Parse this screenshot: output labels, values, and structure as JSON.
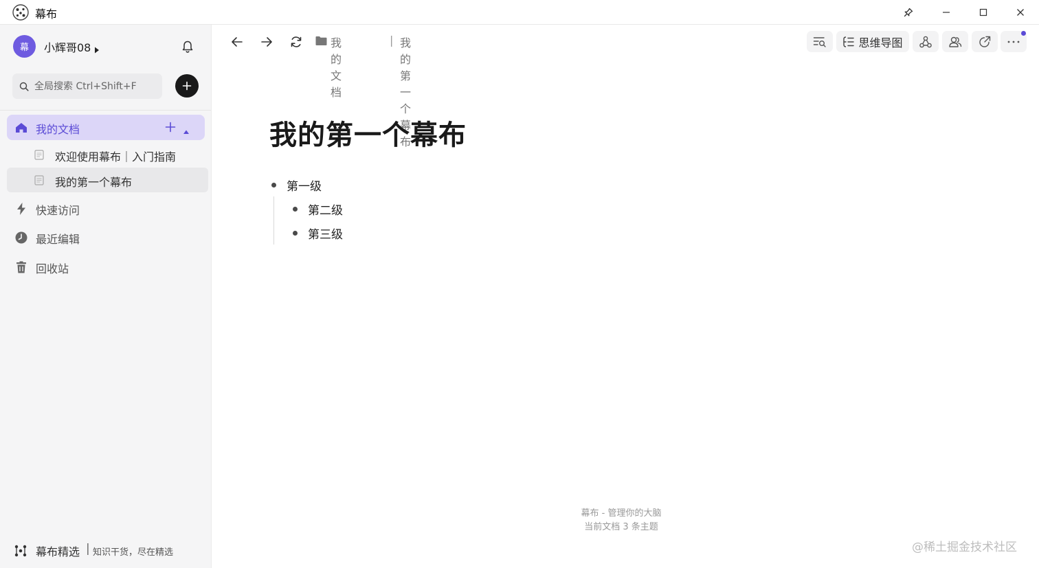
{
  "window": {
    "title": "幕布"
  },
  "sidebar": {
    "user": {
      "avatar_text": "幕",
      "name": "小辉哥08"
    },
    "search": {
      "placeholder": "全局搜索 Ctrl+Shift+F"
    },
    "nav": {
      "my_docs": "我的文档",
      "quick_access": "快速访问",
      "recent_edits": "最近编辑",
      "trash": "回收站"
    },
    "docs": [
      {
        "label": "欢迎使用幕布｜入门指南"
      },
      {
        "label": "我的第一个幕布"
      }
    ],
    "footer": {
      "brand": "幕布精选",
      "separator": "|",
      "slogan": "知识干货，尽在精选"
    }
  },
  "toolbar": {
    "breadcrumb_root": "我的文档",
    "breadcrumb_separator": "|",
    "breadcrumb_current": "我的第一个幕布",
    "mindmap_label": "思维导图"
  },
  "document": {
    "title": "我的第一个幕布",
    "outline": [
      {
        "text": "第一级",
        "children": [
          {
            "text": "第二级"
          },
          {
            "text": "第三级"
          }
        ]
      }
    ]
  },
  "footer": {
    "line1": "幕布 - 管理你的大脑",
    "line2": "当前文档 3 条主题"
  },
  "watermark": "@稀土掘金技术社区",
  "colors": {
    "accent": "#5b4bd6",
    "active_bg": "#dcd6f8",
    "sidebar_bg": "#f5f5f6"
  }
}
